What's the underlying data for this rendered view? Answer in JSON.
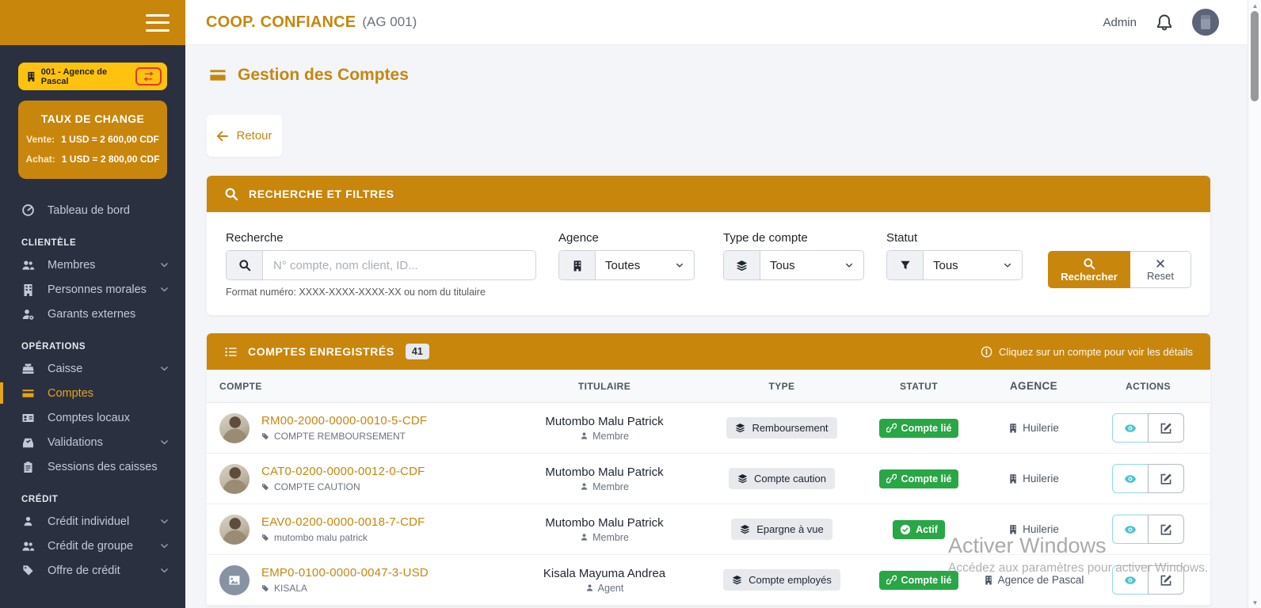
{
  "topbar": {
    "brand": "COOP. CONFIANCE",
    "agency_code": "(AG 001)",
    "user_label": "Admin"
  },
  "sidebar": {
    "agency_button": {
      "label": "001 - Agence de Pascal",
      "icon": "building-icon",
      "action_icon": "swap-icon"
    },
    "exchange_rate": {
      "title": "TAUX DE CHANGE",
      "sell_label": "Vente:",
      "sell_value": "1 USD = 2 600,00 CDF",
      "buy_label": "Achat:",
      "buy_value": "1 USD = 2 800,00 CDF"
    },
    "sections": [
      {
        "items": [
          {
            "label": "Tableau de bord",
            "icon": "gauge-icon"
          }
        ]
      },
      {
        "header": "CLIENTÈLE",
        "items": [
          {
            "label": "Membres",
            "icon": "users-icon",
            "expandable": true
          },
          {
            "label": "Personnes morales",
            "icon": "building-icon",
            "expandable": true
          },
          {
            "label": "Garants externes",
            "icon": "user-badge-icon"
          }
        ]
      },
      {
        "header": "OPÉRATIONS",
        "items": [
          {
            "label": "Caisse",
            "icon": "cash-register-icon",
            "expandable": true
          },
          {
            "label": "Comptes",
            "icon": "credit-card-icon",
            "active": true
          },
          {
            "label": "Comptes locaux",
            "icon": "id-card-icon"
          },
          {
            "label": "Validations",
            "icon": "validation-icon",
            "expandable": true
          },
          {
            "label": "Sessions des caisses",
            "icon": "clipboard-icon"
          }
        ]
      },
      {
        "header": "CRÉDIT",
        "items": [
          {
            "label": "Crédit individuel",
            "icon": "user-icon",
            "expandable": true
          },
          {
            "label": "Crédit de groupe",
            "icon": "users-icon",
            "expandable": true
          },
          {
            "label": "Offre de crédit",
            "icon": "tags-icon",
            "expandable": true
          }
        ]
      }
    ]
  },
  "page": {
    "title": "Gestion des Comptes",
    "back_button": "Retour"
  },
  "filters": {
    "header": "RECHERCHE ET FILTRES",
    "search": {
      "label": "Recherche",
      "placeholder": "N° compte, nom client, ID...",
      "value": "",
      "helper": "Format numéro: XXXX-XXXX-XXXX-XX ou nom du titulaire"
    },
    "agency": {
      "label": "Agence",
      "value": "Toutes"
    },
    "account_type": {
      "label": "Type de compte",
      "value": "Tous"
    },
    "status": {
      "label": "Statut",
      "value": "Tous"
    },
    "search_button": "Rechercher",
    "reset_button": "Reset"
  },
  "accounts_table": {
    "header": "COMPTES ENREGISTRÉS",
    "count": "41",
    "hint": "Cliquez sur un compte pour voir les détails",
    "columns": [
      "COMPTE",
      "TITULAIRE",
      "TYPE",
      "STATUT",
      "AGENCE",
      "ACTIONS"
    ],
    "rows": [
      {
        "account": "RM00-2000-0000-0010-5-CDF",
        "account_label": "COMPTE REMBOURSEMENT",
        "holder": "Mutombo Malu Patrick",
        "holder_role": "Membre",
        "type": "Remboursement",
        "status": "Compte lié",
        "status_kind": "linked",
        "agency": "Huilerie",
        "avatar": "photo"
      },
      {
        "account": "CAT0-0200-0000-0012-0-CDF",
        "account_label": "COMPTE CAUTION",
        "holder": "Mutombo Malu Patrick",
        "holder_role": "Membre",
        "type": "Compte caution",
        "status": "Compte lié",
        "status_kind": "linked",
        "agency": "Huilerie",
        "avatar": "photo"
      },
      {
        "account": "EAV0-0200-0000-0018-7-CDF",
        "account_label": "mutombo malu patrick",
        "holder": "Mutombo Malu Patrick",
        "holder_role": "Membre",
        "type": "Epargne à vue",
        "status": "Actif",
        "status_kind": "active",
        "agency": "Huilerie",
        "avatar": "photo"
      },
      {
        "account": "EMP0-0100-0000-0047-3-USD",
        "account_label": "KISALA",
        "holder": "Kisala Mayuma Andrea",
        "holder_role": "Agent",
        "type": "Compte employés",
        "status": "Compte lié",
        "status_kind": "linked",
        "agency": "Agence de Pascal",
        "avatar": "placeholder"
      }
    ]
  },
  "watermark": {
    "line1": "Activer Windows",
    "line2": "Accédez aux paramètres pour activer Windows."
  },
  "colors": {
    "primary_gold": "#C8860D",
    "accent_yellow": "#FFC20E",
    "success_green": "#28A745",
    "info_teal": "#4EC3CF",
    "sidebar_bg": "#2A3040",
    "swap_red": "#E3342B"
  }
}
